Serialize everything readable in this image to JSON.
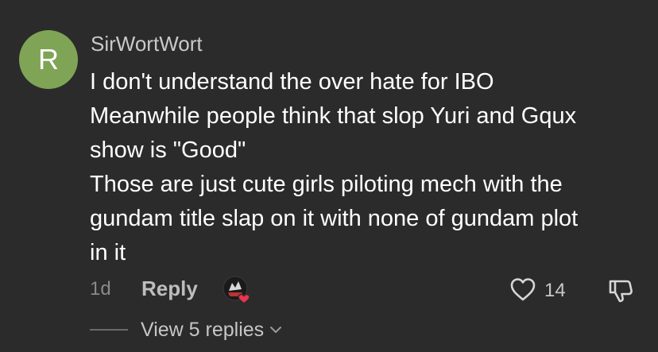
{
  "comment": {
    "avatar_letter": "R",
    "avatar_color": "#7fa456",
    "username": "SirWortWort",
    "lines": [
      "I don't understand the over hate for IBO",
      "Meanwhile people think that slop Yuri and Gqux",
      "show is \"Good\"",
      "Those are just cute girls piloting mech with the",
      "gundam title slap on it with none of gundam plot",
      "in it"
    ],
    "time": "1d",
    "reply_label": "Reply",
    "like_count": "14",
    "view_replies_label": "View 5 replies"
  },
  "icons": {
    "creator_like": "creator-liked-avatar-icon",
    "like": "heart-outline-icon",
    "dislike": "thumbs-down-icon",
    "expand": "chevron-down-icon"
  },
  "colors": {
    "background": "#2b2b2b",
    "heart_accent": "#e8344e"
  }
}
